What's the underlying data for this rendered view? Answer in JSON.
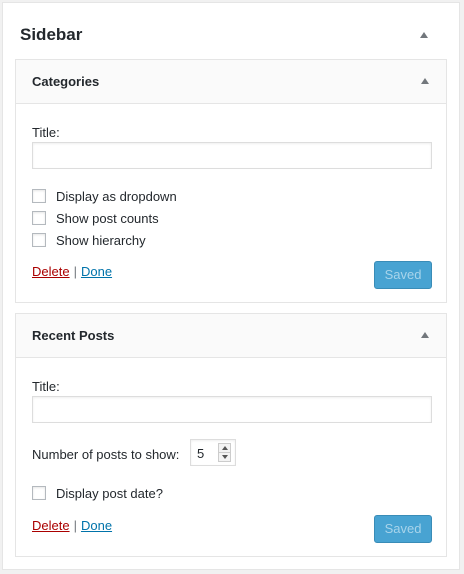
{
  "sidebar": {
    "title": "Sidebar",
    "toggle_icon": "caret-up-icon"
  },
  "widgets": [
    {
      "title": "Categories",
      "title_label": "Title:",
      "title_value": "",
      "options": [
        {
          "label": "Display as dropdown",
          "checked": false
        },
        {
          "label": "Show post counts",
          "checked": false
        },
        {
          "label": "Show hierarchy",
          "checked": false
        }
      ],
      "delete_label": "Delete",
      "separator": "|",
      "done_label": "Done",
      "save_label": "Saved"
    },
    {
      "title": "Recent Posts",
      "title_label": "Title:",
      "title_value": "",
      "number_label": "Number of posts to show:",
      "number_value": "5",
      "options": [
        {
          "label": "Display post date?",
          "checked": false
        }
      ],
      "delete_label": "Delete",
      "separator": "|",
      "done_label": "Done",
      "save_label": "Saved"
    }
  ],
  "colors": {
    "delete_link": "#aa0000",
    "done_link": "#0073aa",
    "saved_button": "#3f9fd0"
  }
}
